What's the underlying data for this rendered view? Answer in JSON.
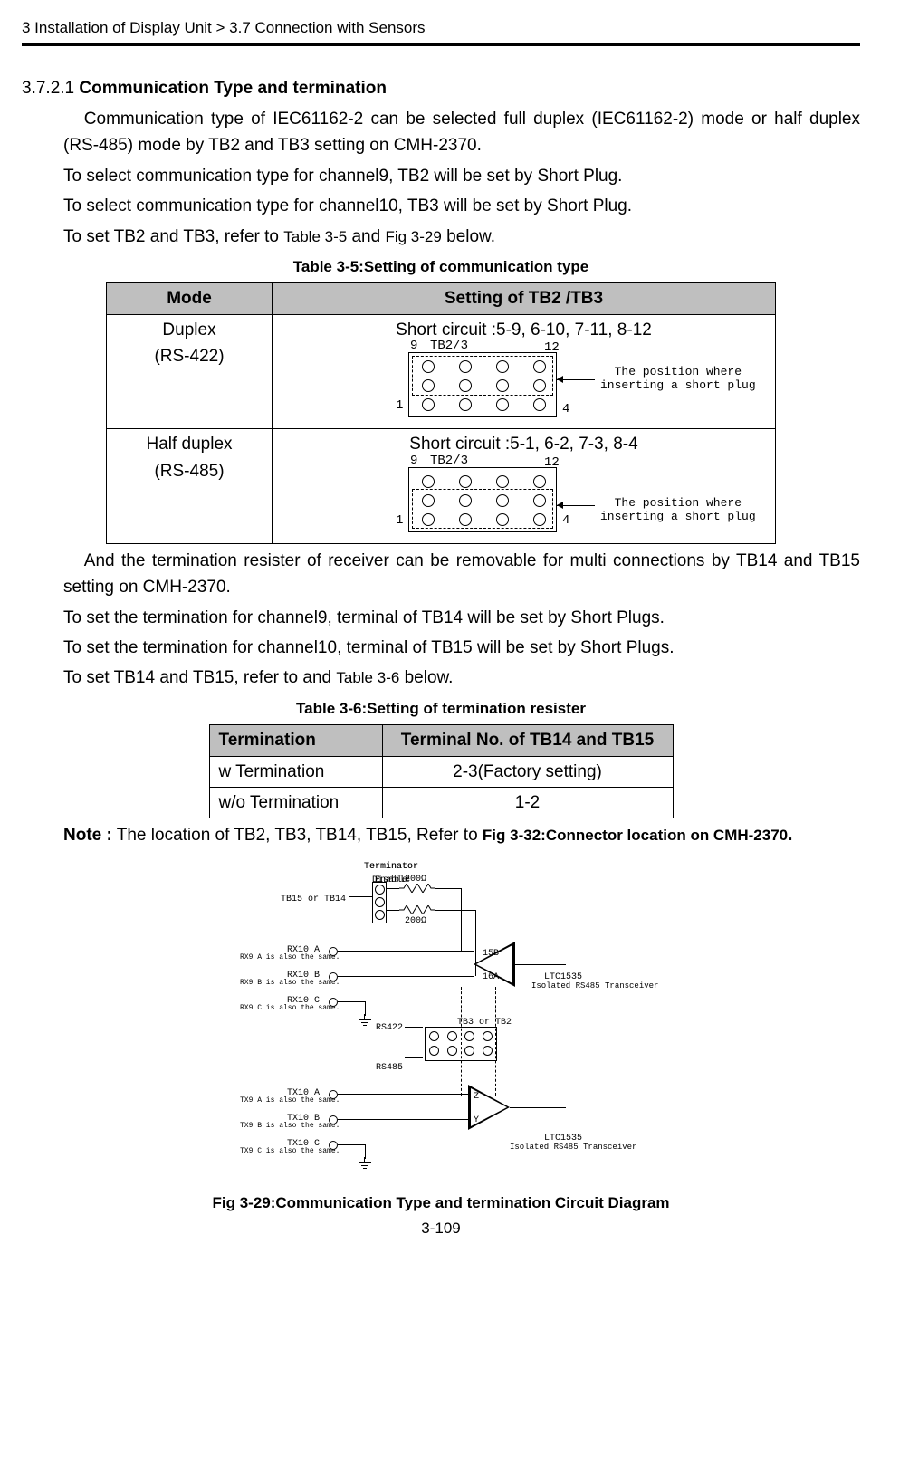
{
  "header": "3 Installation of Display Unit > 3.7 Connection with Sensors",
  "section_number": "3.7.2.1 ",
  "section_title": "Communication Type and termination",
  "para1": "Communication type of IEC61162-2 can be selected full duplex (IEC61162-2) mode or half duplex (RS-485) mode by TB2 and TB3 setting on CMH-2370.",
  "para2": "To select communication type for channel9, TB2 will be set by Short Plug.",
  "para3": "To select communication type for channel10, TB3 will be set by Short Plug.",
  "para4_pre": "To set TB2 and TB3, refer to ",
  "para4_ref1": "Table 3-5",
  "para4_mid": " and ",
  "para4_ref2": "Fig 3-29",
  "para4_post": " below.",
  "table35": {
    "caption": "Table 3-5:Setting of communication type",
    "head": {
      "mode": "Mode",
      "setting": "Setting of TB2 /TB3"
    },
    "rows": [
      {
        "mode_l1": "Duplex",
        "mode_l2": "(RS-422)",
        "short": "Short circuit :5-9, 6-10, 7-11, 8-12",
        "jumper": "TB2/3",
        "n1": "1",
        "n4": "4",
        "n9": "9",
        "n12": "12",
        "note1": "The position where",
        "note2": "inserting a short plug",
        "dash_top": true
      },
      {
        "mode_l1": "Half duplex",
        "mode_l2": "(RS-485)",
        "short": "Short circuit :5-1, 6-2, 7-3, 8-4",
        "jumper": "TB2/3",
        "n1": "1",
        "n4": "4",
        "n9": "9",
        "n12": "12",
        "note1": "The position where",
        "note2": "inserting a short plug",
        "dash_top": false
      }
    ]
  },
  "para5": "And the termination resister of receiver can be removable for multi connections by TB14 and TB15 setting on CMH-2370.",
  "para6": "To set the termination for channel9, terminal of TB14 will be set by Short Plugs.",
  "para7": "To set the termination for channel10, terminal of TB15 will be set by Short Plugs.",
  "para8_pre": "To set TB14 and TB15, refer to and ",
  "para8_ref": "Table 3-6",
  "para8_post": " below.",
  "table36": {
    "caption": "Table 3-6:Setting of termination resister",
    "head": {
      "c1": "Termination",
      "c2": "Terminal No. of TB14 and TB15"
    },
    "rows": [
      {
        "c1": "w Termination",
        "c2": "2-3(Factory setting)"
      },
      {
        "c1": "w/o Termination",
        "c2": "1-2"
      }
    ]
  },
  "note_pre": "Note :",
  "note_body": " The location of TB2, TB3, TB14, TB15, Refer to ",
  "note_ref": "Fig 3-32:Connector location on CMH-2370",
  "note_post": ".",
  "circuit": {
    "term_disable": "Terminator\nDisable",
    "term_enable": "Terminator\nEnable",
    "tb14": "TB15 or TB14",
    "r200a": "200Ω",
    "r200b": "200Ω",
    "rx10a": "RX10 A",
    "rx9a": "RX9 A is also the same.",
    "rx10b": "RX10 B",
    "rx9b": "RX9 B is also the same.",
    "rx10c": "RX10 C",
    "rx9c": "RX9 C is also the same.",
    "tx10a": "TX10 A",
    "tx9a": "TX9 A is also the same.",
    "tx10b": "TX10 B",
    "tx9b": "TX9 B is also the same.",
    "tx10c": "TX10 C",
    "tx9c": "TX9 C is also the same.",
    "rs422": "RS422",
    "rs485": "RS485",
    "tb3": "TB3 or TB2",
    "b15": "15B",
    "a16": "16A",
    "z": "Z",
    "y": "Y",
    "ltc1": "LTC1535",
    "iso1": "Isolated RS485 Transceiver",
    "ltc2": "LTC1535",
    "iso2": "Isolated RS485 Transceiver"
  },
  "fig_caption": "Fig 3-29:Communication Type and termination Circuit Diagram",
  "page": "3-109"
}
